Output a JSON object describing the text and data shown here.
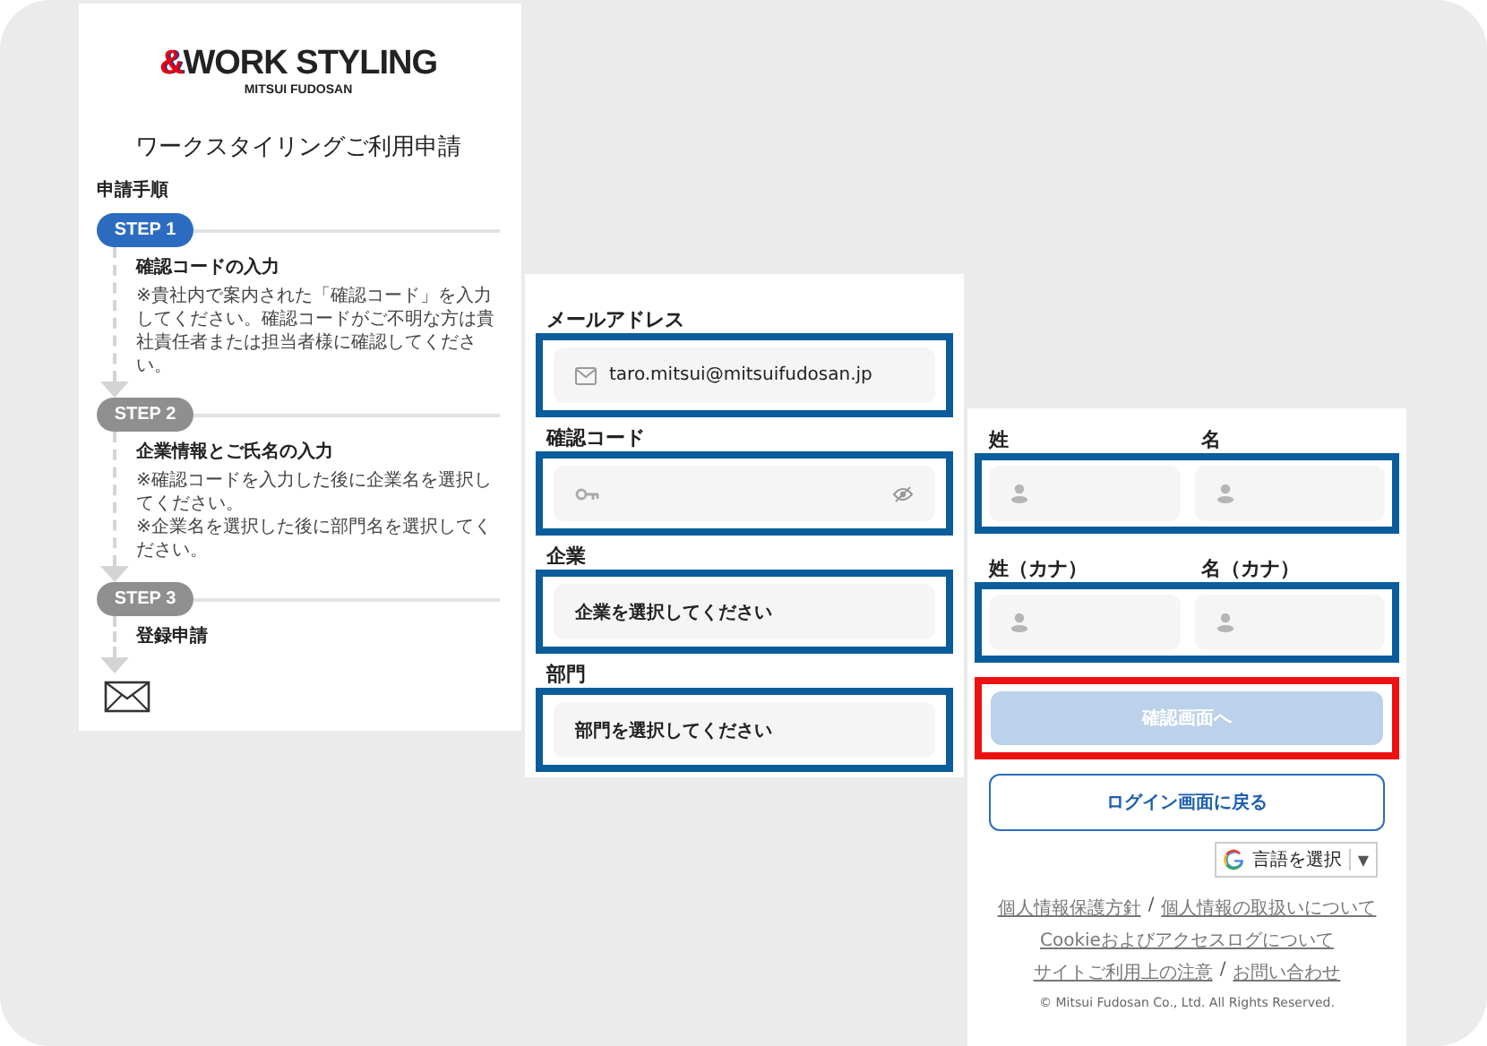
{
  "logo": {
    "mark": "&",
    "name": "WORK STYLING",
    "subtitle": "MITSUI FUDOSAN"
  },
  "page_title": "ワークスタイリングご利用申請",
  "procedure": {
    "heading": "申請手順",
    "steps": [
      {
        "badge": "STEP 1",
        "active": true,
        "title": "確認コードの入力",
        "notes": [
          "※貴社内で案内された「確認コード」を入力してください。確認コードがご不明な方は貴社責任者または担当者様に確認してください。"
        ]
      },
      {
        "badge": "STEP 2",
        "active": false,
        "title": "企業情報とご氏名の入力",
        "notes": [
          "※確認コードを入力した後に企業名を選択してください。",
          "※企業名を選択した後に部門名を選択してください。"
        ]
      },
      {
        "badge": "STEP 3",
        "active": false,
        "title": "登録申請"
      }
    ]
  },
  "fields": [
    {
      "label": "メールアドレス",
      "kind": "email",
      "value": "taro.mitsui@mitsuifudosan.jp",
      "color": "#0a5d9c"
    },
    {
      "label": "確認コード",
      "kind": "code",
      "color": "#0a5d9c"
    },
    {
      "label": "企業",
      "kind": "select",
      "value": "企業を選択してください",
      "color": "#0a5d9c"
    },
    {
      "label": "部門",
      "kind": "select",
      "value": "部門を選択してください",
      "color": "#0a5d9c"
    }
  ],
  "name_rows": [
    {
      "color": "#0a5d9c",
      "fields": [
        {
          "label": "姓"
        },
        {
          "label": "名"
        }
      ]
    },
    {
      "color": "#0a5d9c",
      "fields": [
        {
          "label": "姓（カナ）"
        },
        {
          "label": "名（カナ）"
        }
      ]
    }
  ],
  "confirm_button": {
    "label": "確認画面へ",
    "disabled": true,
    "color": "#ee1111"
  },
  "back_button": {
    "label": "ログイン画面に戻る"
  },
  "language_select": {
    "label": "言語を選択",
    "arrow": "▼"
  },
  "footer_links": [
    {
      "links": [
        "個人情報保護方針",
        "個人情報の取扱いについて"
      ],
      "separator": "/"
    },
    {
      "links": [
        "Cookieおよびアクセスログについて"
      ]
    },
    {
      "links": [
        "サイトご利用上の注意",
        "お問い合わせ"
      ],
      "separator": "/"
    }
  ],
  "copyright": "© Mitsui Fudosan Co., Ltd. All Rights Reserved."
}
